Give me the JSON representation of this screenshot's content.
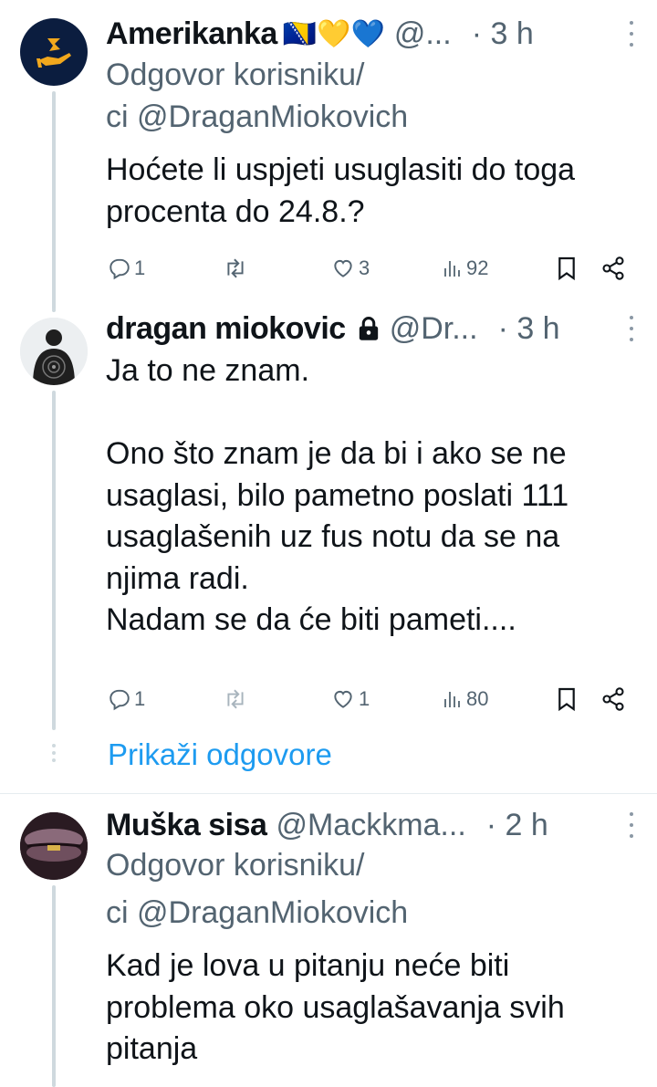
{
  "tweets": [
    {
      "name": "Amerikanka",
      "name_emoji": "🇧🇦💛💙",
      "handle": "@...",
      "time": "· 3 h",
      "reply_to": "Odgovor korisniku/",
      "reply_to_handle": "ci @DraganMiokovich",
      "text": "Hoćete li uspjeti usuglasiti do toga procenta do 24.8.?",
      "replies": "1",
      "retweets": "",
      "likes": "3",
      "views": "92"
    },
    {
      "name": "dragan miokovic",
      "locked": true,
      "handle": "@Dr...",
      "time": "· 3 h",
      "text": "Ja to ne znam.\n\nOno što znam je da bi i ako se ne usaglasi, bilo pametno poslati 111 usaglašenih uz fus notu da se na njima radi.\nNadam se da će biti pameti....",
      "replies": "1",
      "retweets": "",
      "likes": "1",
      "views": "80"
    },
    {
      "name": "Muška sisa",
      "handle": "@Mackkma...",
      "time": "· 2 h",
      "reply_to": "Odgovor korisniku/",
      "reply_to_handle": "ci @DraganMiokovich",
      "text": "Kad je lova u pitanju neće biti problema oko usaglašavanja svih pitanja"
    }
  ],
  "show_replies_label": "Prikaži odgovore",
  "icons": [
    "reply-icon",
    "retweet-icon",
    "like-icon",
    "views-icon",
    "bookmark-icon",
    "share-icon",
    "more-icon",
    "lock-icon"
  ],
  "colors": {
    "text": "#0f1419",
    "muted": "#536471",
    "link": "#1d9bf0",
    "thread": "#cfd9de",
    "avatar1": "#0b1d3f",
    "accent1": "#f2a81d"
  }
}
